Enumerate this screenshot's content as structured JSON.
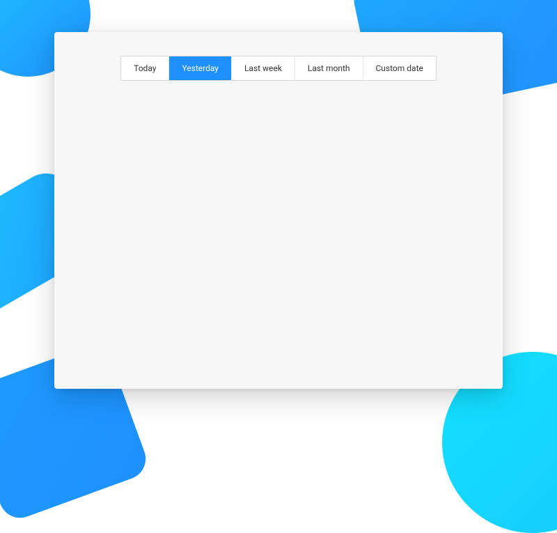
{
  "tabs": {
    "items": [
      {
        "label": "Today"
      },
      {
        "label": "Yesterday"
      },
      {
        "label": "Last week"
      },
      {
        "label": "Last month"
      },
      {
        "label": "Custom date"
      }
    ],
    "active_index": 1
  },
  "colors": {
    "primary": "#1e90ff"
  }
}
